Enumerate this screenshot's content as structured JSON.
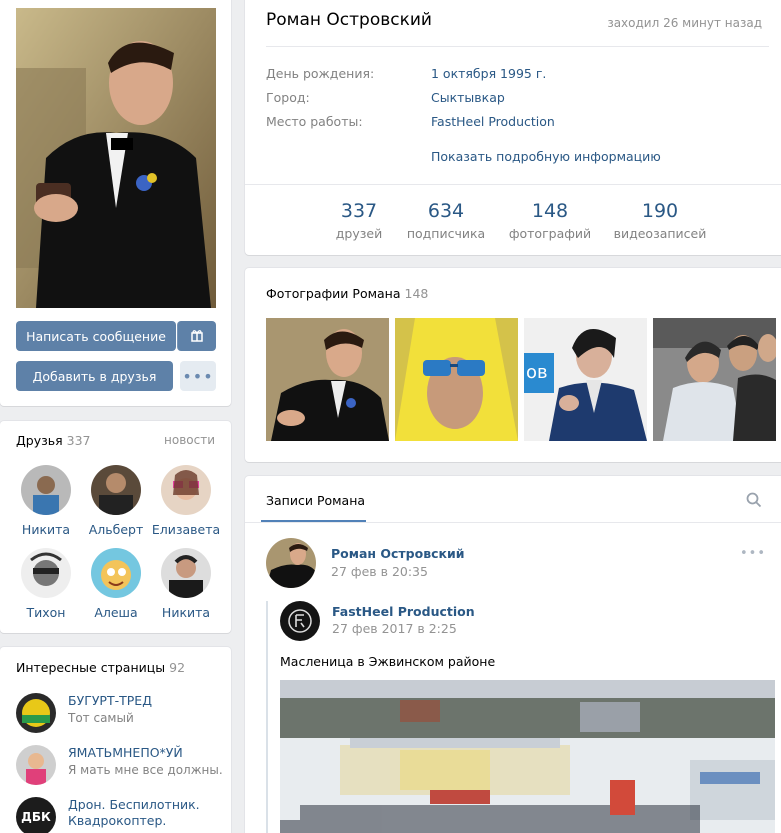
{
  "profile": {
    "name": "Роман Островский",
    "last_seen": "заходил 26 минут назад",
    "info": [
      {
        "label": "День рождения:",
        "value": "1 октября 1995 г."
      },
      {
        "label": "Город:",
        "value": "Сыктывкар"
      },
      {
        "label": "Место работы:",
        "value": "FastHeel Production"
      }
    ],
    "more_info": "Показать подробную информацию",
    "counters": [
      {
        "num": "337",
        "label": "друзей"
      },
      {
        "num": "634",
        "label": "подписчика"
      },
      {
        "num": "148",
        "label": "фотографий"
      },
      {
        "num": "190",
        "label": "видеозаписей"
      }
    ]
  },
  "actions": {
    "message": "Написать сообщение",
    "add_friend": "Добавить в друзья"
  },
  "friends": {
    "title": "Друзья",
    "count": "337",
    "news": "новости",
    "items": [
      {
        "name": "Никита"
      },
      {
        "name": "Альберт"
      },
      {
        "name": "Елизавета"
      },
      {
        "name": "Тихон"
      },
      {
        "name": "Алеша"
      },
      {
        "name": "Никита"
      }
    ]
  },
  "pages": {
    "title": "Интересные страницы",
    "count": "92",
    "items": [
      {
        "title": "БУГУРТ-ТРЕД",
        "subtitle": "Тот самый"
      },
      {
        "title": "ЯМАТЬМНЕПО*УЙ",
        "subtitle": "Я мать мне все должны."
      },
      {
        "title": "Дрон. Беспилотник.",
        "subtitle": "Квадрокоптер."
      }
    ],
    "badge_text": "ДБК"
  },
  "photos": {
    "title": "Фотографии Романа",
    "count": "148"
  },
  "wall": {
    "tab": "Записи Романа",
    "post": {
      "author": "Роман Островский",
      "date": "27 фев в 20:35",
      "repost_author": "FastHeel Production",
      "repost_date": "27 фев 2017 в 2:25",
      "text": "Масленица в Эжвинском районе"
    }
  },
  "colors": {
    "accent": "#2a5885",
    "button": "#5e81a8",
    "background": "#edeef0"
  }
}
